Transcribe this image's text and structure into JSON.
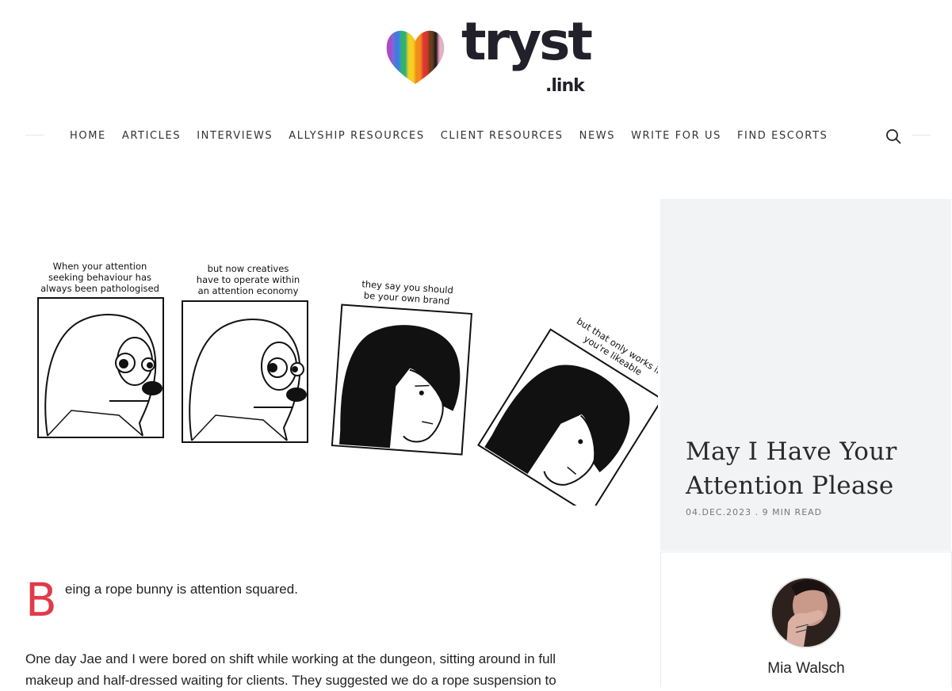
{
  "brand": {
    "name": "tryst",
    "tld": ".link",
    "text_color": "#22202a",
    "heart_icon": "pride-heart-icon"
  },
  "nav": {
    "items": [
      "HOME",
      "ARTICLES",
      "INTERVIEWS",
      "ALLYSHIP RESOURCES",
      "CLIENT RESOURCES",
      "NEWS",
      "WRITE FOR US",
      "FIND ESCORTS"
    ],
    "search_icon": "search-icon"
  },
  "comic": {
    "panels": [
      {
        "caption": [
          "When your attention",
          "seeking behaviour has",
          "always been pathologised"
        ]
      },
      {
        "caption": [
          "but now creatives",
          "have to operate within",
          "an attention economy"
        ]
      },
      {
        "caption": [
          "they say you should",
          "be your own brand"
        ]
      },
      {
        "caption": [
          "but that only works if",
          "you're likeable"
        ]
      }
    ]
  },
  "article": {
    "drop_cap": "B",
    "intro_rest": "eing a rope bunny is attention squared.",
    "paragraph_1": "One day Jae and I were bored on shift while working at the dungeon, sitting around in full",
    "paragraph_1_cont": "makeup and half-dressed waiting for clients. They suggested we do a rope suspension to",
    "accent_color": "#e03b4b"
  },
  "sidebar": {
    "title": "May I Have Your Attention Please",
    "date": "04.DEC.2023",
    "separator": ".",
    "read_time": "9 MIN READ",
    "author": "Mia Walsch",
    "background": "#f2f3f4"
  }
}
